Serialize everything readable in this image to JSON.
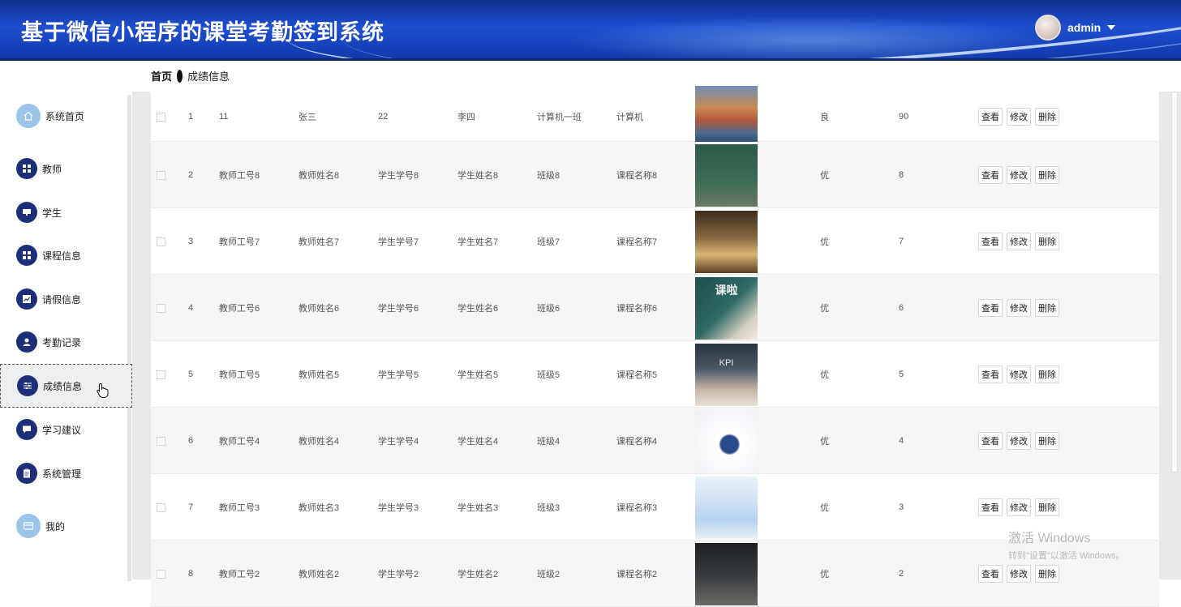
{
  "header": {
    "title": "基于微信小程序的课堂考勤签到系统",
    "username": "admin"
  },
  "sidebar": {
    "items": [
      {
        "label": "系统首页",
        "icon": "home-icon"
      },
      {
        "label": "教师",
        "icon": "grid-icon"
      },
      {
        "label": "学生",
        "icon": "monitor-icon"
      },
      {
        "label": "课程信息",
        "icon": "grid-icon"
      },
      {
        "label": "请假信息",
        "icon": "chart-icon"
      },
      {
        "label": "考勤记录",
        "icon": "user-icon"
      },
      {
        "label": "成绩信息",
        "icon": "sliders-icon"
      },
      {
        "label": "学习建议",
        "icon": "message-icon"
      },
      {
        "label": "系统管理",
        "icon": "clipboard-icon"
      },
      {
        "label": "我的",
        "icon": "card-icon"
      }
    ],
    "active": "成绩信息"
  },
  "breadcrumb": {
    "home": "首页",
    "current": "成绩信息"
  },
  "actions": {
    "view": "查看",
    "edit": "修改",
    "delete": "删除"
  },
  "rows": [
    {
      "index": "1",
      "teacher_id": "11",
      "teacher_name": "张三",
      "student_id": "22",
      "student_name": "李四",
      "class": "计算机一班",
      "course": "计算机",
      "grade": "良",
      "score": "90"
    },
    {
      "index": "2",
      "teacher_id": "教师工号8",
      "teacher_name": "教师姓名8",
      "student_id": "学生学号8",
      "student_name": "学生姓名8",
      "class": "班级8",
      "course": "课程名称8",
      "grade": "优",
      "score": "8"
    },
    {
      "index": "3",
      "teacher_id": "教师工号7",
      "teacher_name": "教师姓名7",
      "student_id": "学生学号7",
      "student_name": "学生姓名7",
      "class": "班级7",
      "course": "课程名称7",
      "grade": "优",
      "score": "7"
    },
    {
      "index": "4",
      "teacher_id": "教师工号6",
      "teacher_name": "教师姓名6",
      "student_id": "学生学号6",
      "student_name": "学生姓名6",
      "class": "班级6",
      "course": "课程名称6",
      "grade": "优",
      "score": "6"
    },
    {
      "index": "5",
      "teacher_id": "教师工号5",
      "teacher_name": "教师姓名5",
      "student_id": "学生学号5",
      "student_name": "学生姓名5",
      "class": "班级5",
      "course": "课程名称5",
      "grade": "优",
      "score": "5"
    },
    {
      "index": "6",
      "teacher_id": "教师工号4",
      "teacher_name": "教师姓名4",
      "student_id": "学生学号4",
      "student_name": "学生姓名4",
      "class": "班级4",
      "course": "课程名称4",
      "grade": "优",
      "score": "4"
    },
    {
      "index": "7",
      "teacher_id": "教师工号3",
      "teacher_name": "教师姓名3",
      "student_id": "学生学号3",
      "student_name": "学生姓名3",
      "class": "班级3",
      "course": "课程名称3",
      "grade": "优",
      "score": "3"
    },
    {
      "index": "8",
      "teacher_id": "教师工号2",
      "teacher_name": "教师姓名2",
      "student_id": "学生学号2",
      "student_name": "学生姓名2",
      "class": "班级2",
      "course": "课程名称2",
      "grade": "优",
      "score": "2"
    }
  ],
  "thumb_texts": {
    "kpi": "KPI",
    "class_banner": "课啦"
  },
  "watermark": {
    "line1": "激活 Windows",
    "line2": "转到\"设置\"以激活 Windows。"
  },
  "colors": {
    "header": "#1e4fd0",
    "nav_icon": "#1d2f78",
    "nav_icon_light": "#9cc4ea"
  }
}
